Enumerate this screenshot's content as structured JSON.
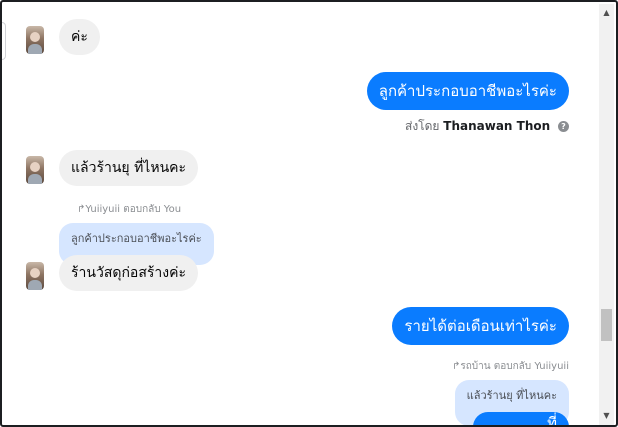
{
  "messages": {
    "m1": {
      "text": "ค่ะ"
    },
    "m2": {
      "text": "ลูกค้าประกอบอาชีพอะไรค่ะ"
    },
    "m2_meta": {
      "prefix": "ส่งโดย",
      "name": "Thanawan Thon",
      "help_icon": "?"
    },
    "m3": {
      "text": "แล้วร้านยุ ที่ไหนคะ"
    },
    "m4_reply": {
      "label": "Yuiiyuii ตอบกลับ You"
    },
    "m4_quote": {
      "text": "ลูกค้าประกอบอาชีพอะไรค่ะ"
    },
    "m4": {
      "text": "ร้านวัสดุก่อสร้างค่ะ"
    },
    "m5": {
      "text": "รายได้ต่อเดือนเท่าไรค่ะ"
    },
    "m6_reply": {
      "label": "รถบ้าน ตอบกลับ Yuiiyuii"
    },
    "m6_quote": {
      "text": "แล้วร้านยุ ที่ไหนคะ"
    },
    "m6": {
      "text": "...ที่"
    }
  },
  "icons": {
    "reply": "↱",
    "scroll_up": "▲",
    "scroll_down": "▼"
  },
  "colors": {
    "outgoing_bubble": "#0a7cff",
    "incoming_bubble": "#f0f0f0",
    "quote_bubble": "#d6e6ff"
  }
}
